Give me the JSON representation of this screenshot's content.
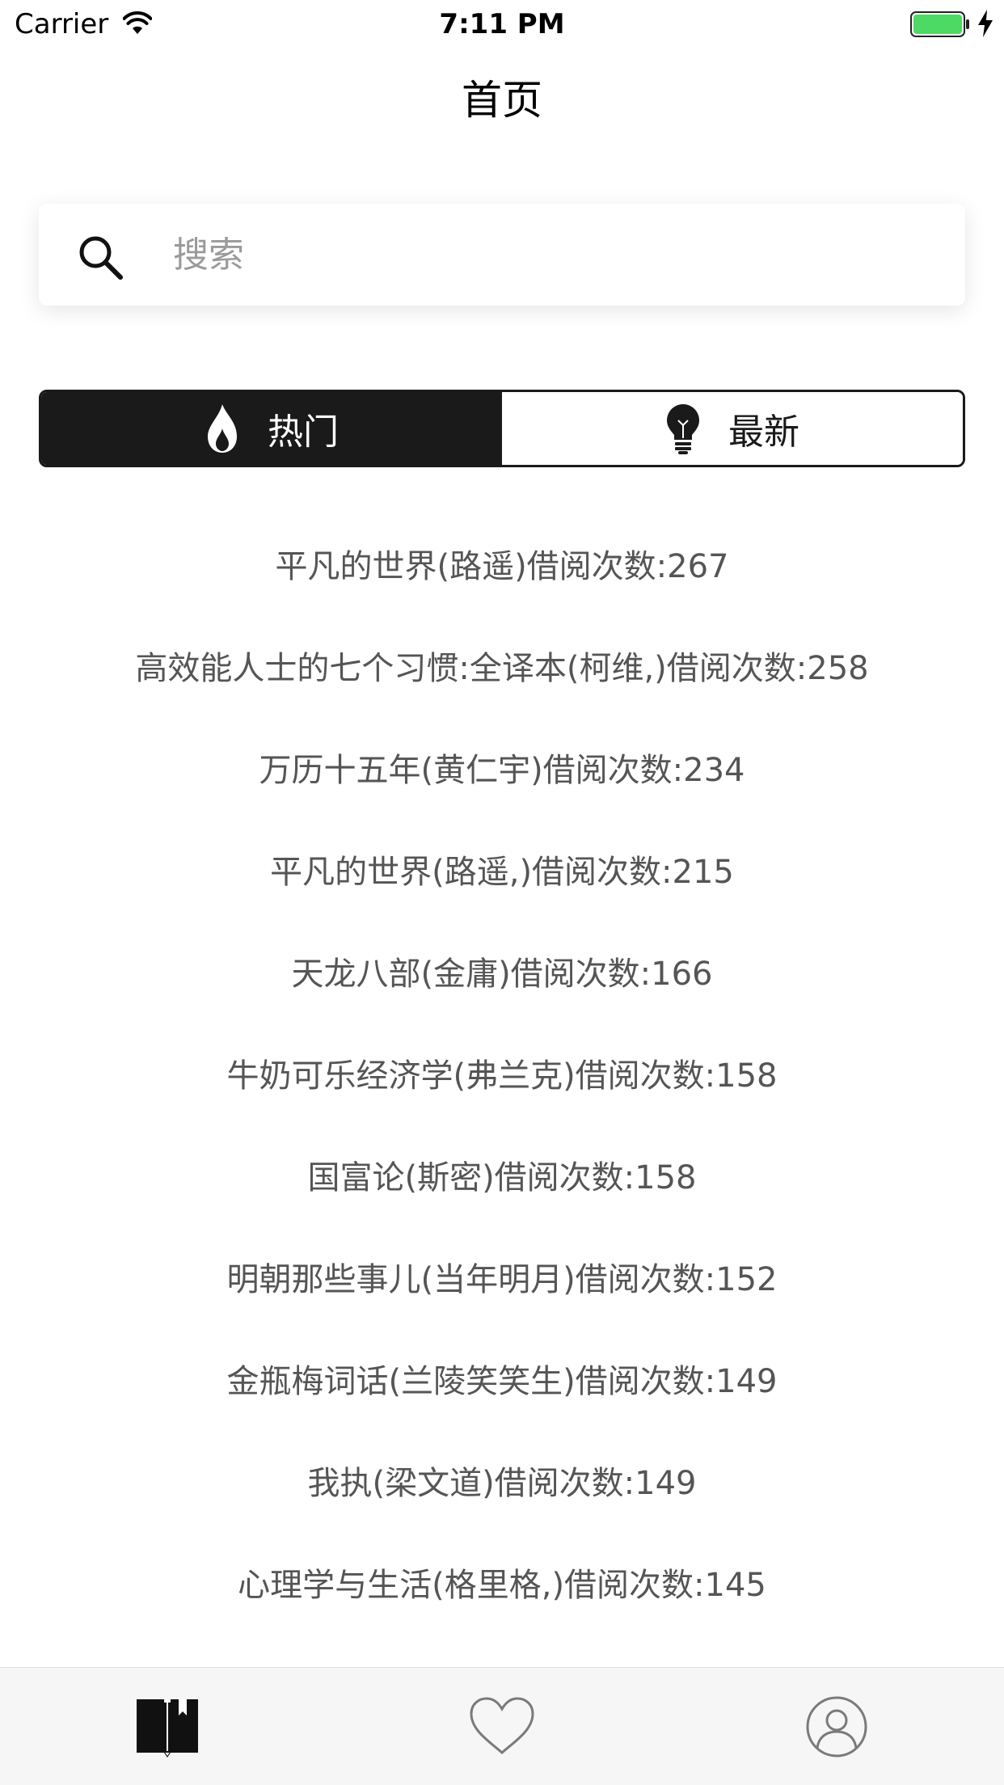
{
  "status_bar": {
    "carrier": "Carrier",
    "time": "7:11 PM",
    "battery_color": "#4cd964"
  },
  "nav": {
    "title": "首页"
  },
  "search": {
    "placeholder": "搜索",
    "value": "",
    "icon": "search-icon"
  },
  "segment": {
    "options": [
      {
        "label": "热门",
        "icon": "flame-icon",
        "selected": true
      },
      {
        "label": "最新",
        "icon": "lightbulb-icon",
        "selected": false
      }
    ]
  },
  "books": [
    {
      "text": "平凡的世界(路遥)借阅次数:267"
    },
    {
      "text": "高效能人士的七个习惯:全译本(柯维,)借阅次数:258"
    },
    {
      "text": "万历十五年(黄仁宇)借阅次数:234"
    },
    {
      "text": "平凡的世界(路遥,)借阅次数:215"
    },
    {
      "text": "天龙八部(金庸)借阅次数:166"
    },
    {
      "text": "牛奶可乐经济学(弗兰克)借阅次数:158"
    },
    {
      "text": "国富论(斯密)借阅次数:158"
    },
    {
      "text": "明朝那些事儿(当年明月)借阅次数:152"
    },
    {
      "text": "金瓶梅词话(兰陵笑笑生)借阅次数:149"
    },
    {
      "text": "我执(梁文道)借阅次数:149"
    },
    {
      "text": "心理学与生活(格里格,)借阅次数:145"
    }
  ],
  "tab_bar": {
    "tabs": [
      {
        "icon": "book-icon",
        "selected": true
      },
      {
        "icon": "heart-icon",
        "selected": false
      },
      {
        "icon": "user-icon",
        "selected": false
      }
    ]
  },
  "colors": {
    "accent": "#1a1a1a",
    "list_text": "#555555",
    "tab_bar_bg": "#f6f6f6"
  }
}
